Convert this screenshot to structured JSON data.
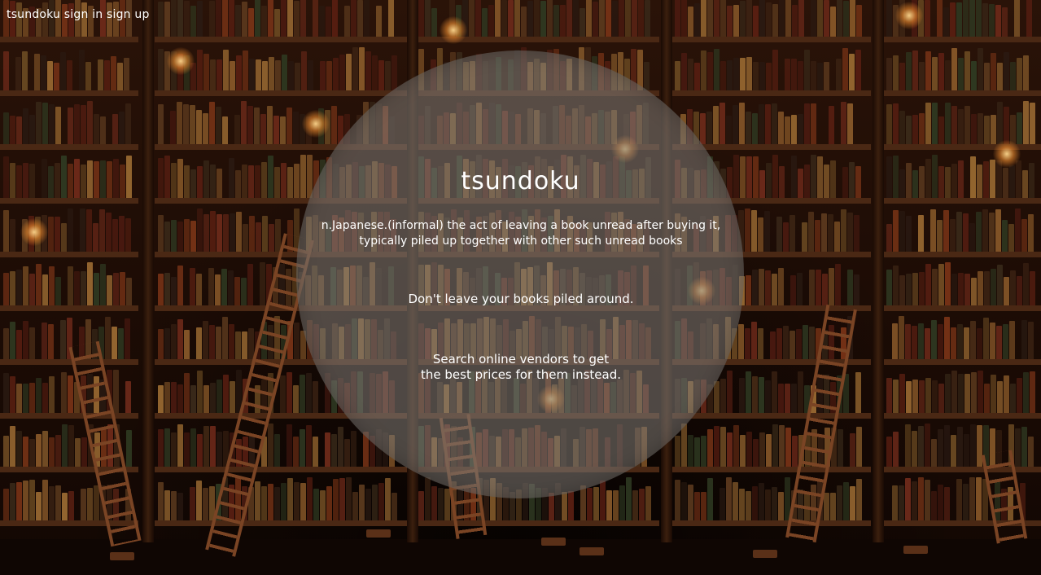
{
  "nav": {
    "brand": "tsundoku",
    "sign_in": "sign in",
    "sign_up": "sign up"
  },
  "hero": {
    "title": "tsundoku",
    "definition_line1": "n.Japanese.(informal) the act of leaving a book unread after buying it,",
    "definition_line2": "typically piled up together with other such unread books",
    "tagline": "Don't leave your books piled around.",
    "cta_line1": "Search online vendors to get",
    "cta_line2": "the best prices for them instead."
  },
  "colors": {
    "overlay": "#7d7873",
    "text": "#ffffff",
    "wood": "#4a2814",
    "background": "#1a0d06"
  }
}
